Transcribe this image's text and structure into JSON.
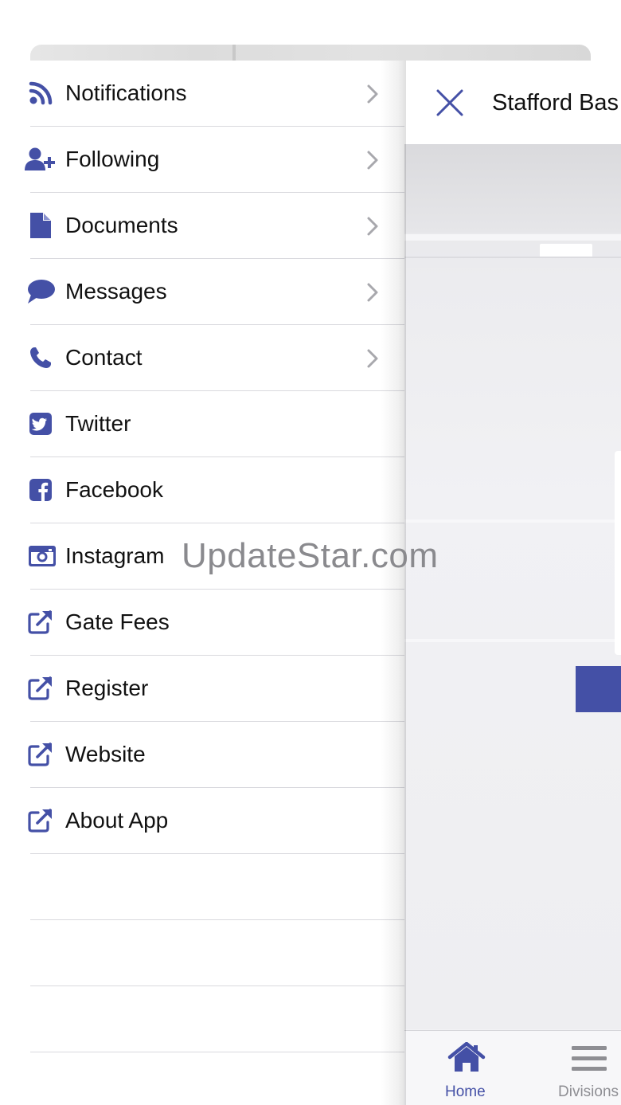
{
  "colors": {
    "accent": "#4450a6",
    "chevron": "#a8a8ad",
    "divider": "#d9d9de",
    "tab_inactive": "#8e8e93"
  },
  "menu": {
    "items": [
      {
        "label": "Notifications",
        "icon": "rss-icon",
        "has_chevron": true
      },
      {
        "label": "Following",
        "icon": "user-plus-icon",
        "has_chevron": true
      },
      {
        "label": "Documents",
        "icon": "document-icon",
        "has_chevron": true
      },
      {
        "label": "Messages",
        "icon": "chat-bubble-icon",
        "has_chevron": true
      },
      {
        "label": "Contact",
        "icon": "phone-icon",
        "has_chevron": true
      },
      {
        "label": "Twitter",
        "icon": "twitter-icon",
        "has_chevron": false
      },
      {
        "label": "Facebook",
        "icon": "facebook-icon",
        "has_chevron": false
      },
      {
        "label": "Instagram",
        "icon": "camera-icon",
        "has_chevron": false
      },
      {
        "label": "Gate Fees",
        "icon": "external-link-icon",
        "has_chevron": false
      },
      {
        "label": "Register",
        "icon": "external-link-icon",
        "has_chevron": false
      },
      {
        "label": "Website",
        "icon": "external-link-icon",
        "has_chevron": false
      },
      {
        "label": "About App",
        "icon": "external-link-icon",
        "has_chevron": false
      }
    ]
  },
  "header": {
    "title": "Stafford Bas",
    "close_icon": "close-icon"
  },
  "tabbar": {
    "tabs": [
      {
        "label": "Home",
        "icon": "home-icon",
        "active": true
      },
      {
        "label": "Divisions",
        "icon": "menu-icon",
        "active": false
      }
    ]
  },
  "watermark": "UpdateStar.com"
}
